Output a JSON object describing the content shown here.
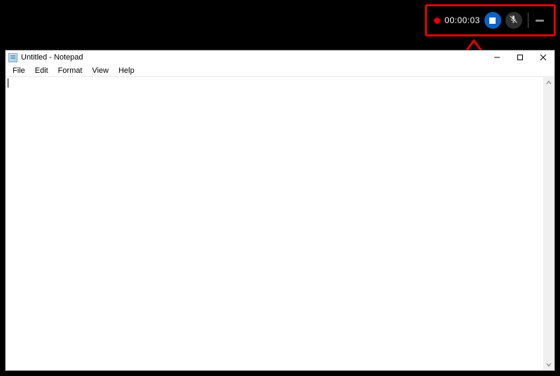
{
  "recording_bar": {
    "timer": "00:00:03"
  },
  "notepad": {
    "title": "Untitled - Notepad",
    "menu": {
      "file": "File",
      "edit": "Edit",
      "format": "Format",
      "view": "View",
      "help": "Help"
    },
    "content": ""
  }
}
